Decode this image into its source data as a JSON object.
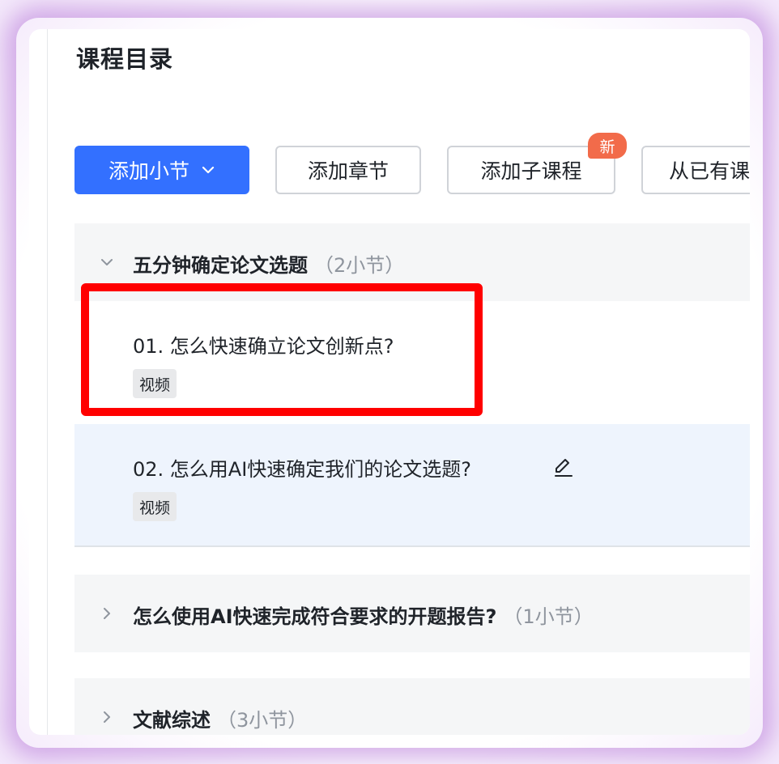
{
  "page": {
    "title": "课程目录"
  },
  "toolbar": {
    "add_section_label": "添加小节",
    "add_chapter_label": "添加章节",
    "add_subcourse_label": "添加子课程",
    "add_subcourse_badge": "新",
    "add_from_existing_label": "从已有课"
  },
  "chapters": [
    {
      "title": "五分钟确定论文选题",
      "count": "（2小节）",
      "expanded": true,
      "lessons": [
        {
          "title": "01. 怎么快速确立论文创新点?",
          "tag": "视频"
        },
        {
          "title": "02. 怎么用AI快速确定我们的论文选题?",
          "tag": "视频"
        }
      ]
    },
    {
      "title": "怎么使用AI快速完成符合要求的开题报告?",
      "count": "（1小节）",
      "expanded": false
    },
    {
      "title": "文献综述",
      "count": "（3小节）",
      "expanded": false
    }
  ],
  "colors": {
    "primary": "#3370ff",
    "badge": "#f26b4a",
    "highlight": "#ff0000",
    "selected_row": "#eef4fd",
    "chapter_bg": "#f5f6f7"
  },
  "icons": {
    "dropdown": "chevron-down-icon",
    "expanded": "chevron-down-icon",
    "collapsed": "chevron-right-icon",
    "edit": "pencil-icon"
  }
}
